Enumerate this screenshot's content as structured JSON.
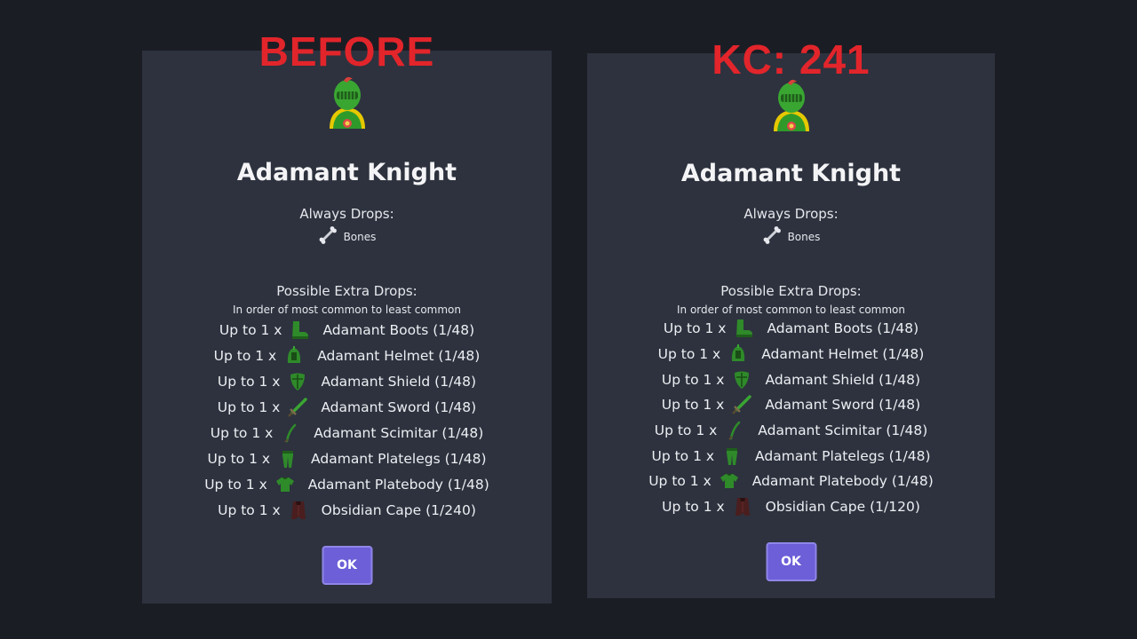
{
  "left": {
    "overlay": "BEFORE",
    "monster_name": "Adamant Knight",
    "always_title": "Always Drops:",
    "always_item": "Bones",
    "possible_title": "Possible Extra Drops:",
    "possible_sub": "In order of most common to least common",
    "drops": [
      {
        "qty": "Up to 1 x",
        "icon": "boots-icon",
        "label": "Adamant Boots (1/48)"
      },
      {
        "qty": "Up to 1 x",
        "icon": "helmet-icon",
        "label": "Adamant Helmet (1/48)"
      },
      {
        "qty": "Up to 1 x",
        "icon": "shield-icon",
        "label": "Adamant Shield (1/48)"
      },
      {
        "qty": "Up to 1 x",
        "icon": "sword-icon",
        "label": "Adamant Sword (1/48)"
      },
      {
        "qty": "Up to 1 x",
        "icon": "scimitar-icon",
        "label": "Adamant Scimitar (1/48)"
      },
      {
        "qty": "Up to 1 x",
        "icon": "platelegs-icon",
        "label": "Adamant Platelegs (1/48)"
      },
      {
        "qty": "Up to 1 x",
        "icon": "platebody-icon",
        "label": "Adamant Platebody (1/48)"
      },
      {
        "qty": "Up to 1 x",
        "icon": "cape-icon",
        "label": "Obsidian Cape (1/240)"
      }
    ],
    "ok_label": "OK"
  },
  "right": {
    "overlay": "KC: 241",
    "monster_name": "Adamant Knight",
    "always_title": "Always Drops:",
    "always_item": "Bones",
    "possible_title": "Possible Extra Drops:",
    "possible_sub": "In order of most common to least common",
    "drops": [
      {
        "qty": "Up to 1 x",
        "icon": "boots-icon",
        "label": "Adamant Boots (1/48)"
      },
      {
        "qty": "Up to 1 x",
        "icon": "helmet-icon",
        "label": "Adamant Helmet (1/48)"
      },
      {
        "qty": "Up to 1 x",
        "icon": "shield-icon",
        "label": "Adamant Shield (1/48)"
      },
      {
        "qty": "Up to 1 x",
        "icon": "sword-icon",
        "label": "Adamant Sword (1/48)"
      },
      {
        "qty": "Up to 1 x",
        "icon": "scimitar-icon",
        "label": "Adamant Scimitar (1/48)"
      },
      {
        "qty": "Up to 1 x",
        "icon": "platelegs-icon",
        "label": "Adamant Platelegs (1/48)"
      },
      {
        "qty": "Up to 1 x",
        "icon": "platebody-icon",
        "label": "Adamant Platebody (1/48)"
      },
      {
        "qty": "Up to 1 x",
        "icon": "cape-icon",
        "label": "Obsidian Cape (1/120)"
      }
    ],
    "ok_label": "OK"
  },
  "colors": {
    "background": "#1b1d24",
    "panel": "#2d323e",
    "overlay_red": "#e2252b",
    "ok_button": "#6c5fd8",
    "adamant_green": "#2f8a2a"
  }
}
